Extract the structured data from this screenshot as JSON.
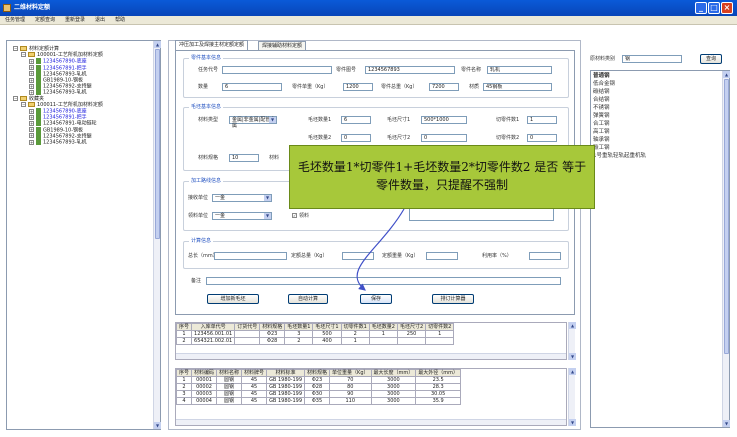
{
  "window": {
    "title": "二维材料定额"
  },
  "menu": [
    "任务管理",
    "定额查询",
    "重新登录",
    "退出",
    "帮助"
  ],
  "tree": [
    {
      "label": "材料定额计算",
      "color": "black",
      "indent": 0,
      "icon": "folder"
    },
    {
      "label": "100001-工艺所机加材料定额",
      "color": "black",
      "indent": 1,
      "icon": "folder"
    },
    {
      "label": "1234567890-底座",
      "color": "blue",
      "indent": 2,
      "icon": "doc"
    },
    {
      "label": "1234567891-把手",
      "color": "blue",
      "indent": 2,
      "icon": "doc"
    },
    {
      "label": "1234567893-轧机",
      "color": "black",
      "indent": 2,
      "icon": "doc"
    },
    {
      "label": "GB1989-10-钢板",
      "color": "black",
      "indent": 2,
      "icon": "doc"
    },
    {
      "label": "1234567892-支持腿",
      "color": "black",
      "indent": 2,
      "icon": "doc"
    },
    {
      "label": "1234567893-轧机",
      "color": "black",
      "indent": 2,
      "icon": "doc"
    },
    {
      "label": "收藏夹",
      "color": "black",
      "indent": 0,
      "icon": "folder"
    },
    {
      "label": "100011-工艺所机加材料定额",
      "color": "black",
      "indent": 1,
      "icon": "folder"
    },
    {
      "label": "1234567890-底座",
      "color": "blue",
      "indent": 2,
      "icon": "doc"
    },
    {
      "label": "1234567891-把手",
      "color": "blue",
      "indent": 2,
      "icon": "doc"
    },
    {
      "label": "1234567891-电动链轮",
      "color": "black",
      "indent": 2,
      "icon": "doc"
    },
    {
      "label": "GB1989-10-钢板",
      "color": "black",
      "indent": 2,
      "icon": "doc"
    },
    {
      "label": "1234567892-支持腿",
      "color": "black",
      "indent": 2,
      "icon": "doc"
    },
    {
      "label": "1234567893-轧机",
      "color": "black",
      "indent": 2,
      "icon": "doc"
    }
  ],
  "tabs": {
    "active": "冲压加工及焊接主材定额定额",
    "inactive": "焊接辅助材料定额"
  },
  "parts": {
    "title": "零件基本信息",
    "task_no_label": "任务代号",
    "task_no": "",
    "part_no_label": "零件图号",
    "part_no": "1234567893",
    "part_name_label": "零件名称",
    "part_name": "轧机",
    "qty_label": "数量",
    "qty": "6",
    "unit_weight_label": "零件单重（Kg）",
    "unit_weight": "1200",
    "total_weight_label": "零件总重（Kg）",
    "total_weight": "7200",
    "material_label": "材质",
    "material": "45钢板"
  },
  "blank": {
    "title": "毛坯基本信息",
    "type_label": "材料类型",
    "type": "金属|非金属|配管金属",
    "qty1_label": "毛坯数量1",
    "qty1": "6",
    "size1_label": "毛坯尺寸1",
    "size1": "500*1000",
    "cut1_label": "切零件数1",
    "cut1": "1",
    "qty2_label": "毛坯数量2",
    "qty2": "0",
    "size2_label": "毛坯尺寸2",
    "size2": "0",
    "cut2_label": "切零件数2",
    "cut2": "0",
    "spec_label": "材料规格",
    "spec": "10",
    "spec2_label": "材料"
  },
  "proc": {
    "title": "加工路线信息",
    "recv_label": "接收单位",
    "recv": "一金",
    "pick_label": "领料单位",
    "pick": "一金",
    "chk_label": "领料"
  },
  "calc": {
    "title": "计算信息",
    "len_label": "总长（mm）",
    "len": "",
    "quota_label": "定额总量（Kg）",
    "quota": "",
    "mquota_label": "定额重量（Kg）",
    "mquota": "",
    "rate_label": "利用率（%）",
    "rate": "",
    "note_label": "备注",
    "note": ""
  },
  "buttons": {
    "add_blank": "增加新毛坯",
    "auto_calc": "自动计算",
    "save": "保存",
    "order": "排订计算器"
  },
  "table1": {
    "headers": [
      "序号",
      "入库单代号",
      "订货代号",
      "材料规格",
      "毛坯数量1",
      "毛坯尺寸1",
      "切零件数1",
      "毛坯数量2",
      "毛坯尺寸2",
      "切零件数2"
    ],
    "rows": [
      [
        "1",
        "123456.001.01",
        "",
        "Φ23",
        "3",
        "500",
        "2",
        "1",
        "250",
        "1"
      ],
      [
        "2",
        "654321.002.01",
        "",
        "Φ28",
        "2",
        "400",
        "1",
        "",
        "",
        ""
      ]
    ]
  },
  "table2": {
    "headers": [
      "序号",
      "材料编码",
      "材料名称",
      "材料牌号",
      "材料标准",
      "材料规格",
      "单位重量（Kg）",
      "最大长度（mm）",
      "最大外径（mm）"
    ],
    "rows": [
      [
        "1",
        "00001",
        "圆钢",
        "45",
        "GB 1980-199",
        "Φ23",
        "70",
        "3000",
        "23.5"
      ],
      [
        "2",
        "00002",
        "圆钢",
        "45",
        "GB 1980-199",
        "Φ28",
        "80",
        "3000",
        "28.3"
      ],
      [
        "3",
        "00003",
        "圆钢",
        "45",
        "GB 1980-199",
        "Φ30",
        "90",
        "3000",
        "30.05"
      ],
      [
        "4",
        "00004",
        "圆钢",
        "45",
        "GB 1980-199",
        "Φ35",
        "110",
        "3000",
        "35.9"
      ]
    ]
  },
  "right": {
    "search_label": "原材料类别",
    "search_value": "钢",
    "search_button": "查询",
    "items": [
      "普通钢",
      "低合金钢",
      "碳结钢",
      "合结钢",
      "不锈钢",
      "弹簧钢",
      "合工钢",
      "高工钢",
      "轴承钢",
      "碳工钢",
      "1号重轨轻轨起重机轨"
    ]
  },
  "callout": "毛坯数量1*切零件1+毛坯数量2*切零件数2 是否 等于 零件数量，只提醒不强制"
}
